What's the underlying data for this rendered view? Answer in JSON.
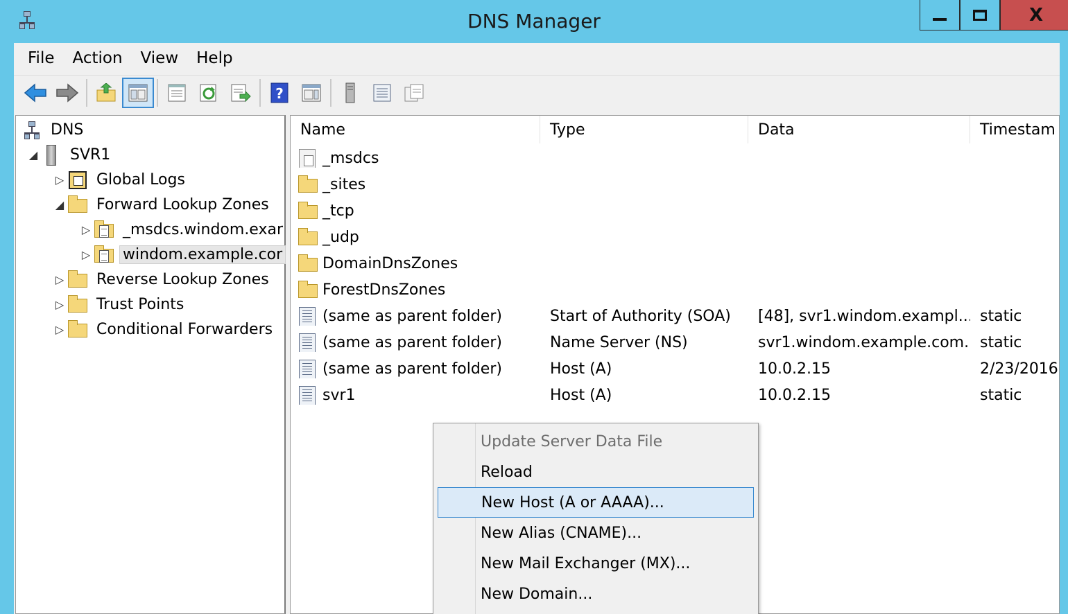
{
  "window": {
    "title": "DNS Manager",
    "minimize_icon": "minimize-icon",
    "maximize_icon": "maximize-icon",
    "close_glyph": "X"
  },
  "menubar": {
    "items": [
      "File",
      "Action",
      "View",
      "Help"
    ]
  },
  "toolbar": {
    "buttons": [
      "back-arrow-icon",
      "forward-arrow-icon",
      "up-folder-icon",
      "show-hide-tree-icon",
      "properties-icon",
      "refresh-icon",
      "export-list-icon",
      "help-icon",
      "action-pane-icon",
      "server-icon",
      "list-view-icon",
      "details-view-icon"
    ]
  },
  "tree": {
    "root": "DNS",
    "server": "SVR1",
    "global_logs": "Global Logs",
    "forward_zones": "Forward Lookup Zones",
    "zone_msdcs": "_msdcs.windom.exar",
    "zone_windom": "windom.example.cor",
    "reverse_zones": "Reverse Lookup Zones",
    "trust_points": "Trust Points",
    "conditional_forwarders": "Conditional Forwarders"
  },
  "list": {
    "columns": [
      "Name",
      "Type",
      "Data",
      "Timestam"
    ],
    "rows": [
      {
        "name": "_msdcs",
        "type": "",
        "data": "",
        "timestamp": "",
        "icon": "delegated-zone-icon"
      },
      {
        "name": "_sites",
        "type": "",
        "data": "",
        "timestamp": "",
        "icon": "folder-icon"
      },
      {
        "name": "_tcp",
        "type": "",
        "data": "",
        "timestamp": "",
        "icon": "folder-icon"
      },
      {
        "name": "_udp",
        "type": "",
        "data": "",
        "timestamp": "",
        "icon": "folder-icon"
      },
      {
        "name": "DomainDnsZones",
        "type": "",
        "data": "",
        "timestamp": "",
        "icon": "folder-icon"
      },
      {
        "name": "ForestDnsZones",
        "type": "",
        "data": "",
        "timestamp": "",
        "icon": "folder-icon"
      },
      {
        "name": "(same as parent folder)",
        "type": "Start of Authority (SOA)",
        "data": "[48], svr1.windom.exampl...",
        "timestamp": "static",
        "icon": "record-icon"
      },
      {
        "name": "(same as parent folder)",
        "type": "Name Server (NS)",
        "data": "svr1.windom.example.com.",
        "timestamp": "static",
        "icon": "record-icon"
      },
      {
        "name": "(same as parent folder)",
        "type": "Host (A)",
        "data": "10.0.2.15",
        "timestamp": "2/23/2016",
        "icon": "record-icon"
      },
      {
        "name": "svr1",
        "type": "Host (A)",
        "data": "10.0.2.15",
        "timestamp": "static",
        "icon": "record-icon"
      }
    ]
  },
  "context_menu": {
    "items": [
      {
        "label": "Update Server Data File",
        "state": "disabled"
      },
      {
        "label": "Reload",
        "state": "normal"
      },
      {
        "label": "New Host (A or AAAA)...",
        "state": "highlighted"
      },
      {
        "label": "New Alias (CNAME)...",
        "state": "normal"
      },
      {
        "label": "New Mail Exchanger (MX)...",
        "state": "normal"
      },
      {
        "label": "New Domain...",
        "state": "normal"
      }
    ]
  },
  "colors": {
    "titlebar": "#65c7e8",
    "close_button": "#c74f4f",
    "menu_highlight": "#dbeaf8",
    "menu_highlight_border": "#3a8ad0",
    "folder": "#f5d77a"
  }
}
